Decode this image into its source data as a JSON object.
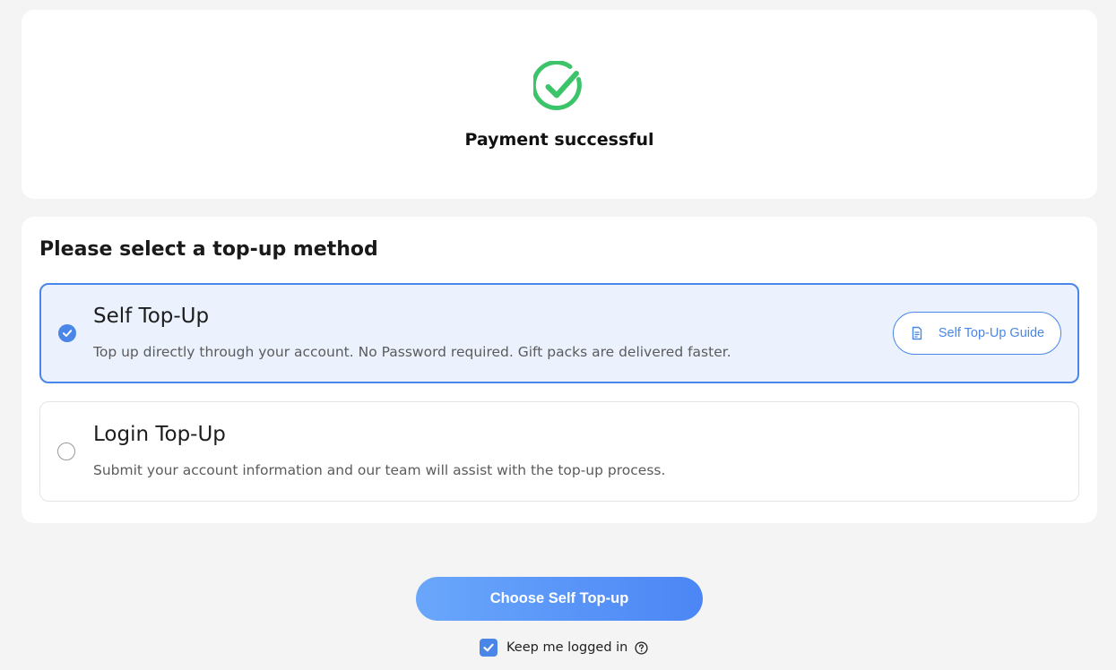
{
  "success": {
    "icon": "check-circle-icon",
    "title": "Payment successful",
    "color": "#3cc46b"
  },
  "method_section": {
    "heading": "Please select a top-up method",
    "options": [
      {
        "title": "Self Top-Up",
        "description": "Top up directly through your account. No Password required. Gift packs are delivered faster.",
        "selected": true,
        "guide_button": {
          "icon": "document-icon",
          "label": "Self Top-Up Guide"
        }
      },
      {
        "title": "Login Top-Up",
        "description": "Submit your account information and our team will assist with the top-up process.",
        "selected": false
      }
    ]
  },
  "cta": {
    "label": "Choose Self Top-up"
  },
  "keep_logged_in": {
    "label": "Keep me logged in",
    "checked": true,
    "help_icon": "question-circle-icon"
  },
  "colors": {
    "accent": "#4a86e8",
    "selected_bg": "#ebf2fe",
    "page_bg": "#f4f4f5",
    "success": "#3cc46b"
  }
}
